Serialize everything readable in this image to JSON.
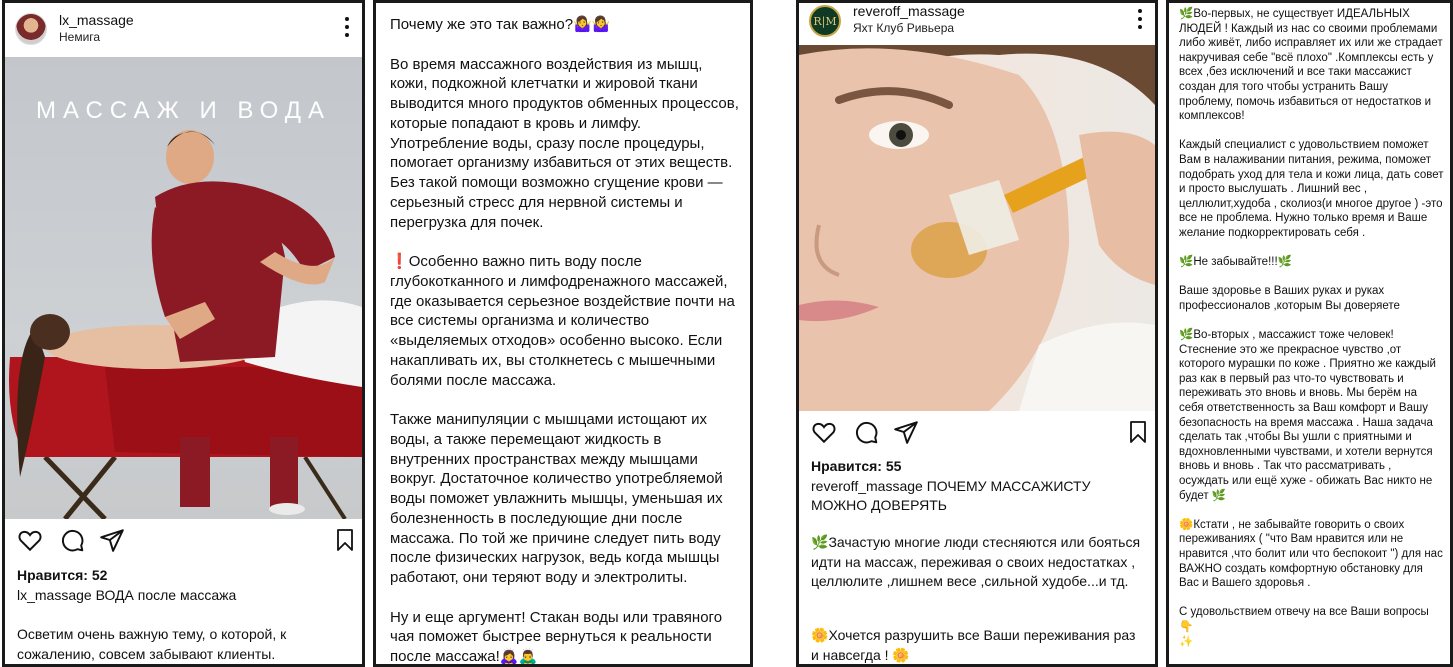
{
  "post1": {
    "username": "lx_massage",
    "location": "Немига",
    "photo_caption": "МАССАЖ И ВОДА",
    "likes": "Нравится: 52",
    "caption_user": "lx_massage",
    "caption_text": "ВОДА после массажа",
    "body": "Осветим очень важную тему, о которой, к сожалению, совсем забывают клиенты."
  },
  "post2": {
    "p1": "Почему же это так важно?🤷‍♀️🤷‍♀️",
    "p2": "Во время массажного воздействия из мышц, кожи, подкожной клетчатки и жировой ткани выводится много продуктов обменных процессов, которые попадают в кровь и лимфу. Употребление воды, сразу после процедуры, помогает организму избавиться от этих веществ. Без такой помощи возможно сгущение крови — серьезный стресс для нервной системы и перегрузка для почек.",
    "p3_mark": "❗",
    "p3": "Особенно важно пить воду после глубокотканного и лимфодренажного массажей, где оказывается серьезное воздействие почти на все системы организма и количество «выделяемых отходов» особенно высоко. Если накапливать их, вы столкнетесь с мышечными болями после массажа.",
    "p4": "Также манипуляции с мышцами истощают их воды, а также перемещают жидкость в внутренних пространствах между мышцами вокруг. Достаточное количество употребляемой воды поможет увлажнить мышцы, уменьшая их болезненность в последующие дни после массажа. По той же причине следует пить воду после физических нагрузок, ведь когда мышцы работают, они теряют воду и электролиты.",
    "p5": "Ну и еще аргумент! Стакан воды или травяного чая поможет быстрее вернуться к реальности после массажа!🙇‍♀️🙇‍♂️"
  },
  "post3": {
    "username": "reveroff_massage",
    "location": "Яхт Клуб Ривьера",
    "avatar_text": "R|M",
    "likes": "Нравится: 55",
    "caption_user": "reveroff_massage",
    "caption_text": "ПОЧЕМУ МАССАЖИСТУ МОЖНО ДОВЕРЯТЬ",
    "p1_mark": "🌿",
    "p1": "Зачастую многие люди стесняются или бояться идти на массаж, переживая о своих недостатках , целлюлите ,лишнем весе ,сильной худобе...и тд.",
    "p2_mark": "🌼",
    "p2": "Хочется разрушить все Ваши переживания раз и навсегда !",
    "p2_end": "🌼"
  },
  "post4": {
    "p1": "🌿Во-первых, не существует ИДЕАЛЬНЫХ ЛЮДЕЙ ! Каждый из нас со своими проблемами либо живёт, либо исправляет их или же страдает накручивая себе \"всё плохо\" .Комплексы есть у всех ,без исключений и все таки массажист создан для того чтобы устранить Вашу проблему, помочь избавиться от недостатков и комплексов!",
    "p2": "Каждый специалист с удовольствием поможет Вам в налаживании  питания, режима, поможет подобрать уход для тела и кожи лица, дать совет и просто выслушать . Лишний вес , целлюлит,худоба , сколиоз(и многое другое ) -это все не проблема. Нужно только время и Ваше желание подкорректировать себя .",
    "p3": "🌿Не забывайте!!!🌿",
    "p4": "Ваше здоровье в Ваших руках и руках профессионалов ,которым Вы доверяете",
    "p5": "🌿Во-вторых , массажист тоже человек! Стеснение это же прекрасное чувство ,от которого мурашки по коже . Приятно же каждый раз как в первый раз что-то чувствовать и переживать это вновь и вновь. Мы берём на себя ответственность за Ваш комфорт и Вашу безопасность на время массажа . Наша задача сделать так ,чтобы Вы ушли с приятными и вдохновленными чувствами, и хотели вернутся вновь и вновь . Так что рассматривать , осуждать или ещё хуже - обижать Вас никто не будет 🌿",
    "p6": "🌼Кстати , не забывайте говорить о своих переживаниях ( \"что Вам нравится или не нравится ,что болит или что беспокоит \") для нас ВАЖНО создать комфортную обстановку для Вас и Вашего здоровья .",
    "p7": "С удовольствием отвечу на все Ваши вопросы 👇",
    "p8": "✨"
  }
}
